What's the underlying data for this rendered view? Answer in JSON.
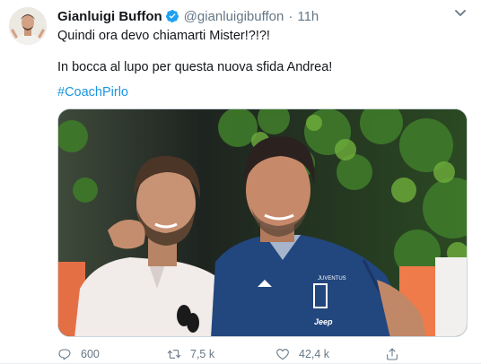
{
  "tweet": {
    "author_name": "Gianluigi Buffon",
    "handle": "@gianluigibuffon",
    "separator": "·",
    "time": "11h",
    "line1": "Quindi ora devo chiamarti Mister!?!?!",
    "line2": "In bocca al lupo per questa nuova sfida Andrea!",
    "hashtag": "#CoachPirlo",
    "photo_jersey_logo_text": "JUVENTUS",
    "photo_jersey_sponsor": "Jeep"
  },
  "actions": {
    "reply_count": "600",
    "retweet_count": "7,5 k",
    "like_count": "42,4 k"
  },
  "colors": {
    "link": "#1b95e0",
    "verified": "#1da1f2",
    "muted": "#657786"
  },
  "icons": [
    "verified-badge-icon",
    "chevron-down-icon",
    "reply-icon",
    "retweet-icon",
    "heart-icon",
    "share-icon"
  ]
}
